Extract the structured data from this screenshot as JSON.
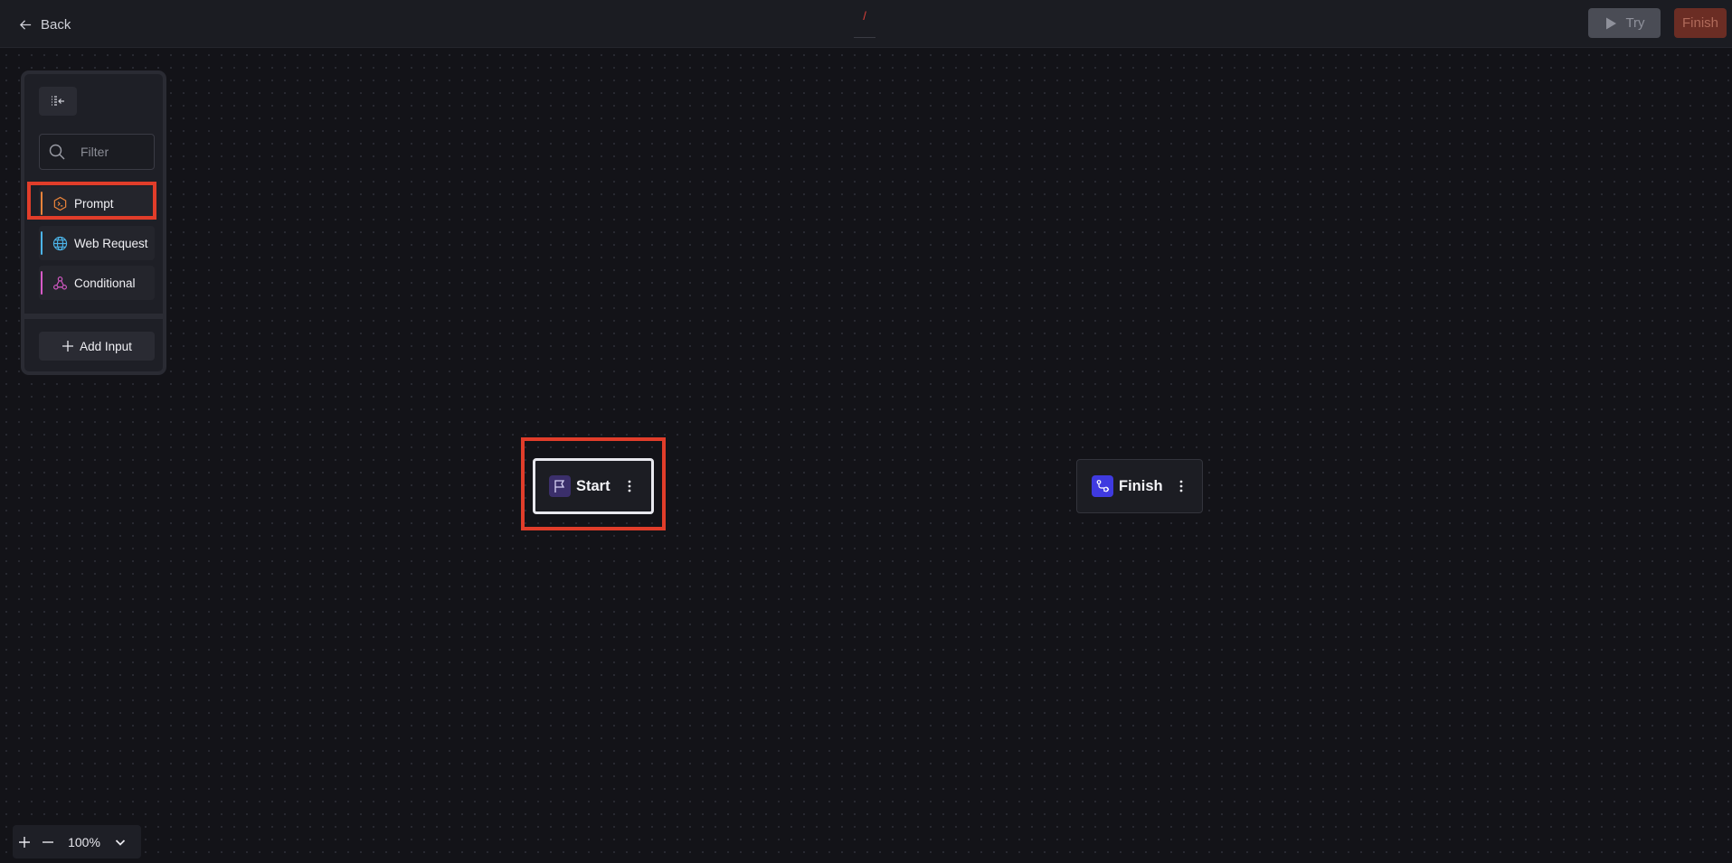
{
  "header": {
    "back_label": "Back",
    "breadcrumb": "/",
    "try_label": "Try",
    "finish_label": "Finish",
    "colors": {
      "finish_button": "#6b2d24",
      "try_button": "#4a4c55",
      "highlight": "#e13d2a"
    }
  },
  "sidebar": {
    "filter": {
      "placeholder": "Filter",
      "value": ""
    },
    "items": [
      {
        "label": "Prompt",
        "icon": "prompt-hexagon-icon",
        "accent": "#e8833a",
        "highlighted": true
      },
      {
        "label": "Web Request",
        "icon": "globe-icon",
        "accent": "#4cb4e8",
        "highlighted": false
      },
      {
        "label": "Conditional",
        "icon": "conditional-branch-icon",
        "accent": "#d85ac8",
        "highlighted": false
      }
    ],
    "add_input_label": "Add Input"
  },
  "canvas": {
    "nodes": [
      {
        "title": "Start",
        "icon": "flag-icon",
        "icon_bg": "#3b2f6b",
        "selected": true,
        "highlighted": true
      },
      {
        "title": "Finish",
        "icon": "route-icon",
        "icon_bg": "#3f3ae0",
        "selected": false,
        "highlighted": false
      }
    ]
  },
  "zoom": {
    "level": "100%"
  }
}
